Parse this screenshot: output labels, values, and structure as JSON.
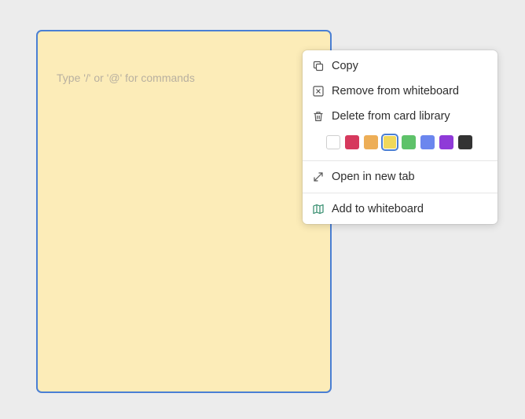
{
  "card": {
    "placeholder": "Type '/' or '@' for commands",
    "background": "#fcecb8",
    "border_color": "#4a7fd4"
  },
  "menu": {
    "items": [
      {
        "label": "Copy",
        "icon": "copy-icon"
      },
      {
        "label": "Remove from whiteboard",
        "icon": "close-box-icon"
      },
      {
        "label": "Delete from card library",
        "icon": "trash-icon"
      },
      {
        "label": "Open in new tab",
        "icon": "expand-arrows-icon"
      },
      {
        "label": "Add to whiteboard",
        "icon": "map-icon"
      }
    ],
    "colors": [
      {
        "name": "white",
        "hex": "#ffffff"
      },
      {
        "name": "red",
        "hex": "#d6395d"
      },
      {
        "name": "orange",
        "hex": "#edae57"
      },
      {
        "name": "yellow",
        "hex": "#f0d85b",
        "selected": true
      },
      {
        "name": "green",
        "hex": "#5ec26a"
      },
      {
        "name": "blue",
        "hex": "#6b86ee"
      },
      {
        "name": "purple",
        "hex": "#8f3ad8"
      },
      {
        "name": "black",
        "hex": "#333333"
      }
    ]
  }
}
